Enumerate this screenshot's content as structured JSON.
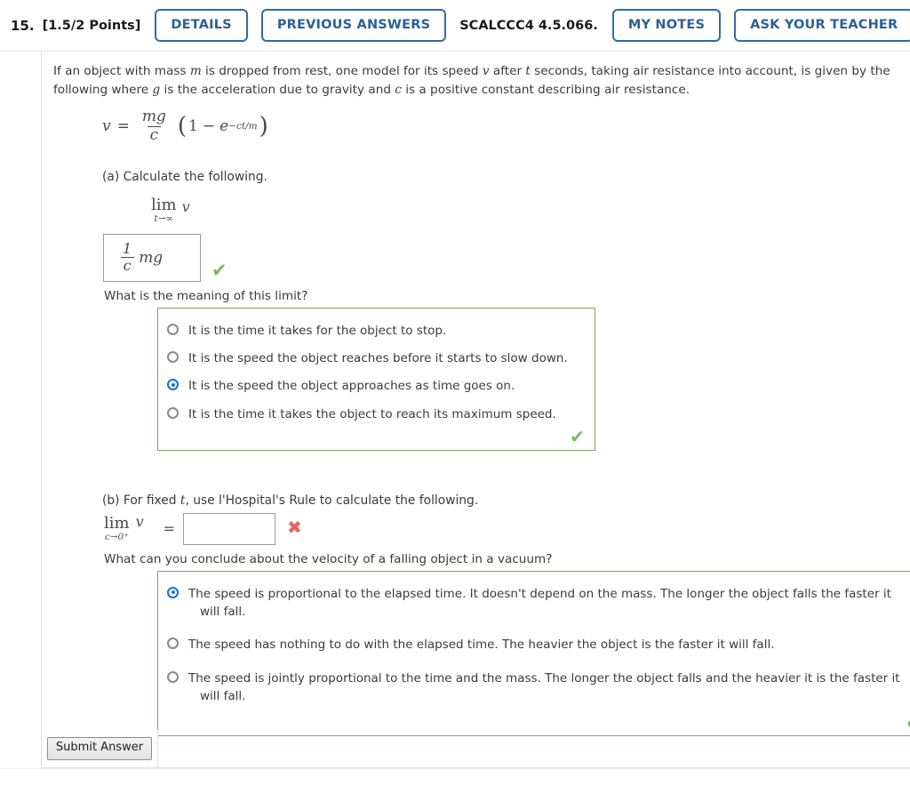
{
  "header": {
    "question_number": "15.",
    "points": "[1.5/2 Points]",
    "details_label": "DETAILS",
    "previous_answers_label": "PREVIOUS ANSWERS",
    "problem_code": "SCALCCC4 4.5.066.",
    "my_notes_label": "MY NOTES",
    "ask_teacher_label": "ASK YOUR TEACHER"
  },
  "problem": {
    "intro_1": "If an object with mass ",
    "intro_var_m": "m",
    "intro_2": " is dropped from rest, one model for its speed ",
    "intro_var_v": "v",
    "intro_3": " after ",
    "intro_var_t": "t",
    "intro_4": " seconds, taking air resistance into account, is given by the following where ",
    "intro_var_g": "g",
    "intro_5": " is the acceleration due to gravity and ",
    "intro_var_c": "c",
    "intro_6": " is a positive constant describing air resistance.",
    "formula": {
      "lhs": "v",
      "equals": "=",
      "frac_num": "mg",
      "frac_den": "c",
      "open_paren": "(",
      "one": "1",
      "minus": "−",
      "e": "e",
      "exponent": "−ct/m",
      "close_paren": ")"
    }
  },
  "part_a": {
    "label": "(a) Calculate the following.",
    "limit_op": "lim",
    "limit_sub": "t→∞",
    "limit_var": "v",
    "answer_value": {
      "num": "1",
      "den": "c",
      "trailing": "mg"
    },
    "answer_status_icon": "green-check",
    "sub_question": "What is the meaning of this limit?",
    "options": [
      {
        "text": "It is the time it takes for the object to stop.",
        "selected": false
      },
      {
        "text": "It is the speed the object reaches before it starts to slow down.",
        "selected": false
      },
      {
        "text": "It is the speed the object approaches as time goes on.",
        "selected": true
      },
      {
        "text": "It is the time it takes the object to reach its maximum speed.",
        "selected": false
      }
    ],
    "options_status_icon": "green-check"
  },
  "part_b": {
    "label_1": "(b) For fixed ",
    "label_var_t": "t",
    "label_2": ", use l'Hospital's Rule to calculate the following.",
    "limit_op": "lim",
    "limit_sub": "c→0⁺",
    "limit_var": "v",
    "equals": "=",
    "answer_value": "",
    "answer_placeholder": "",
    "answer_status_icon": "red-x",
    "sub_question": "What can you conclude about the velocity of a falling object in a vacuum?",
    "options": [
      {
        "line1": "The speed is proportional to the elapsed time. It doesn't depend on the mass. The longer the object falls the faster it",
        "line2": "will fall.",
        "selected": true
      },
      {
        "line1": "The speed has nothing to do with the elapsed time. The heavier the object is the faster it will fall.",
        "line2": "",
        "selected": false
      },
      {
        "line1": "The speed is jointly proportional to the time and the mass. The longer the object falls and the heavier it is the faster it",
        "line2": "will fall.",
        "selected": false
      }
    ],
    "options_status_icon": "green-check"
  },
  "footer": {
    "submit_label": "Submit Answer"
  },
  "icons": {
    "check": "✔",
    "xmark": "✖"
  },
  "colors": {
    "accent_blue": "#2e6da4",
    "correct_green": "#77bb63",
    "incorrect_red": "#e26460",
    "option_box_border": "#7aa463",
    "radio_selected": "#1773d6"
  }
}
